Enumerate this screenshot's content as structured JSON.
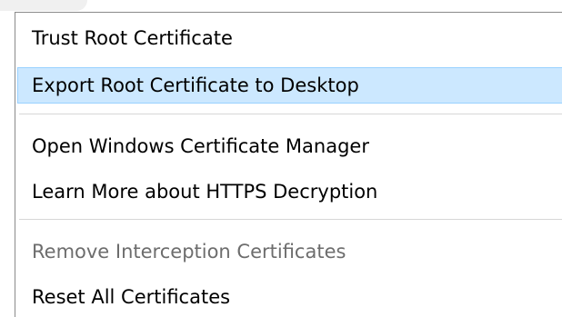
{
  "menu": {
    "items": [
      {
        "label": "Trust Root Certificate",
        "enabled": true
      },
      {
        "label": "Export Root Certificate to Desktop",
        "enabled": true,
        "highlighted": true
      },
      {
        "label": "Open Windows Certificate Manager",
        "enabled": true
      },
      {
        "label": "Learn More about HTTPS Decryption",
        "enabled": true
      },
      {
        "label": "Remove Interception Certificates",
        "enabled": false
      },
      {
        "label": "Reset All Certificates",
        "enabled": true
      }
    ]
  },
  "colors": {
    "highlight_bg": "#cce8ff",
    "highlight_border": "#99d1ff",
    "disabled_text": "#6d6d6d",
    "separator": "#d7d7d7"
  }
}
